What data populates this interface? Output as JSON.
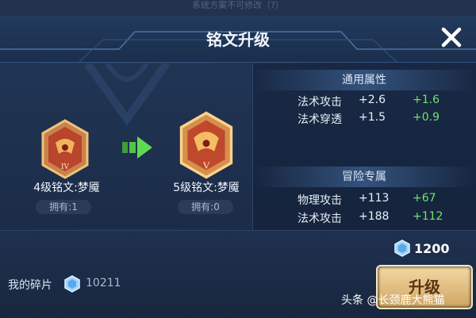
{
  "top_hint": "系统方案不可修改（?）",
  "header": {
    "title": "铭文升级"
  },
  "current_rune": {
    "level_roman": "IV",
    "name": "4级铭文:梦魇",
    "owned": "拥有:1"
  },
  "next_rune": {
    "level_roman": "V",
    "name": "5级铭文:梦魇",
    "owned": "拥有:0"
  },
  "sections": [
    {
      "title": "通用属性",
      "rows": [
        {
          "name": "法术攻击",
          "value": "+2.6",
          "delta": "+1.6"
        },
        {
          "name": "法术穿透",
          "value": "+1.5",
          "delta": "+0.9"
        }
      ]
    },
    {
      "title": "冒险专属",
      "rows": [
        {
          "name": "物理攻击",
          "value": "+113",
          "delta": "+67"
        },
        {
          "name": "法术攻击",
          "value": "+188",
          "delta": "+112"
        }
      ]
    }
  ],
  "cost": "1200",
  "fragments": {
    "label": "我的碎片",
    "count": "10211"
  },
  "upgrade_button": "升级",
  "watermark": "头条 @长颈鹿大熊猫",
  "colors": {
    "delta_green": "#6ee36a",
    "button_gold": "#e6c27e",
    "background": "#1a2942"
  }
}
